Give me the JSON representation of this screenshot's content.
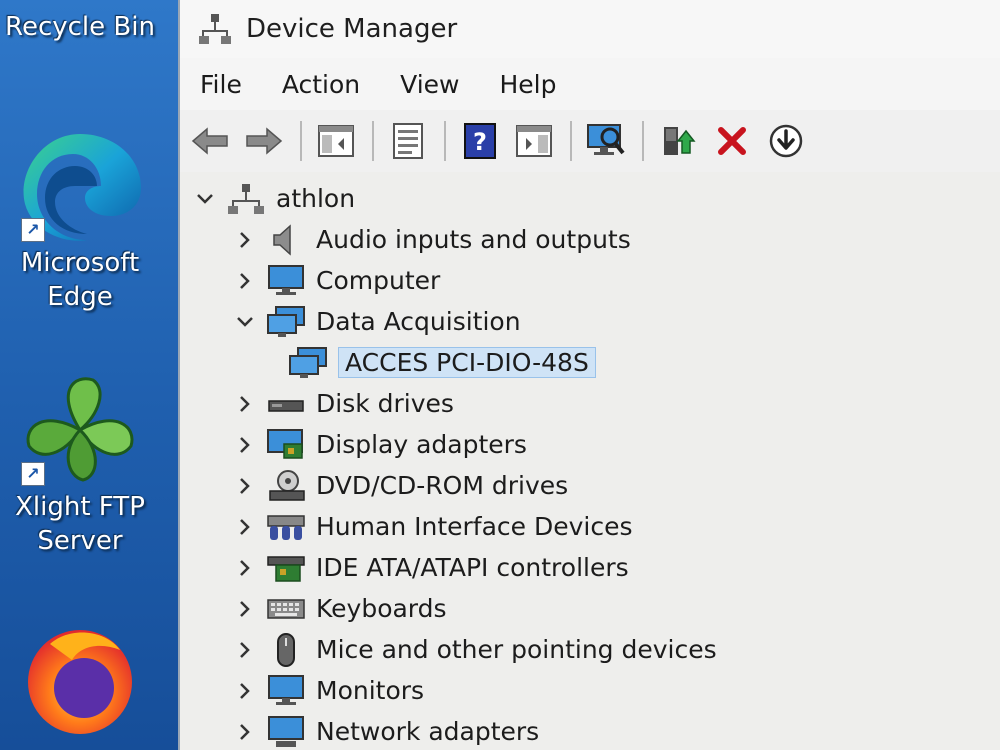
{
  "desktop": {
    "icons": [
      {
        "label": "Recycle Bin"
      },
      {
        "label": "Microsoft Edge"
      },
      {
        "label": "Xlight FTP Server"
      },
      {
        "label": ""
      }
    ]
  },
  "window": {
    "title": "Device Manager",
    "menu": [
      "File",
      "Action",
      "View",
      "Help"
    ],
    "toolbar": [
      {
        "icon": "back-arrow-icon"
      },
      {
        "icon": "forward-arrow-icon"
      },
      {
        "icon": "show-hide-console-tree-icon"
      },
      {
        "icon": "properties-icon"
      },
      {
        "icon": "help-icon"
      },
      {
        "icon": "action-pane-icon"
      },
      {
        "icon": "scan-hardware-icon"
      },
      {
        "icon": "update-driver-icon"
      },
      {
        "icon": "uninstall-icon"
      },
      {
        "icon": "download-icon"
      }
    ]
  },
  "tree": {
    "root": "athlon",
    "items": [
      {
        "label": "Audio inputs and outputs",
        "expanded": false
      },
      {
        "label": "Computer",
        "expanded": false
      },
      {
        "label": "Data Acquisition",
        "expanded": true
      },
      {
        "label": "ACCES PCI-DIO-48S",
        "child": true,
        "selected": true
      },
      {
        "label": "Disk drives",
        "expanded": false
      },
      {
        "label": "Display adapters",
        "expanded": false
      },
      {
        "label": "DVD/CD-ROM drives",
        "expanded": false
      },
      {
        "label": "Human Interface Devices",
        "expanded": false
      },
      {
        "label": "IDE ATA/ATAPI controllers",
        "expanded": false
      },
      {
        "label": "Keyboards",
        "expanded": false
      },
      {
        "label": "Mice and other pointing devices",
        "expanded": false
      },
      {
        "label": "Monitors",
        "expanded": false
      },
      {
        "label": "Network adapters",
        "expanded": false
      }
    ]
  },
  "colors": {
    "desktop": "#1f5fae",
    "selection": "#cfe3f6",
    "monitor_blue": "#3b8fd9"
  }
}
